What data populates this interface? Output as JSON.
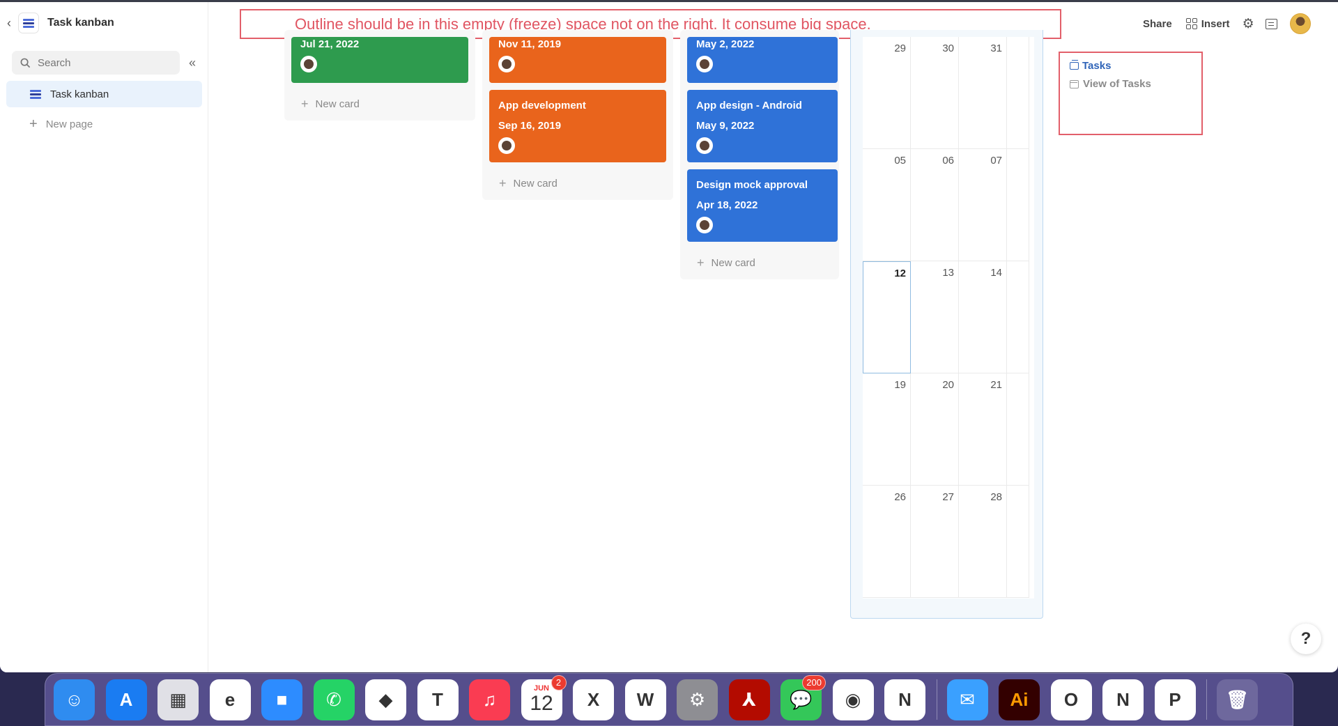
{
  "sidebar": {
    "back_glyph": "‹",
    "title": "Task kanban",
    "search_placeholder": "Search",
    "collapse_glyph": "«",
    "items": [
      {
        "label": "Task kanban",
        "icon": "kanban-icon"
      }
    ],
    "new_page_label": "New page"
  },
  "toolbar": {
    "share_label": "Share",
    "insert_label": "Insert",
    "settings_icon": "gear-icon",
    "comments_icon": "comment-icon"
  },
  "annotation": {
    "text": "Outline should be in this empty (freeze) space not on the right. It consume big space.",
    "color": "#e25f6a"
  },
  "kanban": {
    "columns": [
      {
        "color": "#2e9b4e",
        "cards": [
          {
            "date": "Jul 21, 2022"
          }
        ],
        "new_card_label": "New card"
      },
      {
        "color": "#e9641c",
        "cards": [
          {
            "date": "Nov 11, 2019"
          },
          {
            "title": "App development",
            "date": "Sep 16, 2019"
          }
        ],
        "new_card_label": "New card"
      },
      {
        "color": "#2f72d8",
        "cards": [
          {
            "date": "May 2, 2022"
          },
          {
            "title": "App design - Android",
            "date": "May 9, 2022"
          },
          {
            "title": "Design mock approval",
            "date": "Apr 18, 2022"
          }
        ],
        "new_card_label": "New card"
      }
    ]
  },
  "calendar": {
    "rows": [
      [
        "29",
        "30",
        "31"
      ],
      [
        "05",
        "06",
        "07"
      ],
      [
        "12",
        "13",
        "14"
      ],
      [
        "19",
        "20",
        "21"
      ],
      [
        "26",
        "27",
        "28"
      ]
    ],
    "today": "12"
  },
  "outline": {
    "items": [
      {
        "label": "Tasks",
        "active": true
      },
      {
        "label": "View of Tasks",
        "active": false
      }
    ]
  },
  "help_label": "?",
  "dock": {
    "apps": [
      {
        "name": "finder",
        "color": "#2f8cf0",
        "glyph": "☺"
      },
      {
        "name": "app-store",
        "color": "#1a7cf2",
        "glyph": "A"
      },
      {
        "name": "launchpad",
        "color": "#e0e0e6",
        "glyph": "▦"
      },
      {
        "name": "edge",
        "color": "#ffffff",
        "glyph": "e"
      },
      {
        "name": "zoom",
        "color": "#2d8cff",
        "glyph": "■"
      },
      {
        "name": "whatsapp",
        "color": "#25d366",
        "glyph": "✆"
      },
      {
        "name": "affinity",
        "color": "#ffffff",
        "glyph": "◆"
      },
      {
        "name": "teams",
        "color": "#ffffff",
        "glyph": "T"
      },
      {
        "name": "music",
        "color": "#fa3c52",
        "glyph": "♫"
      },
      {
        "name": "calendar",
        "color": "#ffffff",
        "glyph": "12",
        "month": "JUN",
        "badge": "2"
      },
      {
        "name": "excel",
        "color": "#ffffff",
        "glyph": "X"
      },
      {
        "name": "word",
        "color": "#ffffff",
        "glyph": "W"
      },
      {
        "name": "system-settings",
        "color": "#8e8e93",
        "glyph": "⚙"
      },
      {
        "name": "acrobat",
        "color": "#b30b00",
        "glyph": "⅄"
      },
      {
        "name": "messages",
        "color": "#34c759",
        "glyph": "💬",
        "badge": "200"
      },
      {
        "name": "chrome",
        "color": "#ffffff",
        "glyph": "◉"
      },
      {
        "name": "notion",
        "color": "#ffffff",
        "glyph": "N"
      },
      {
        "name": "mail",
        "color": "#3aa0ff",
        "glyph": "✉"
      },
      {
        "name": "illustrator",
        "color": "#330000",
        "glyph": "Ai"
      },
      {
        "name": "outlook",
        "color": "#ffffff",
        "glyph": "O"
      },
      {
        "name": "news",
        "color": "#ffffff",
        "glyph": "N"
      },
      {
        "name": "powerpoint",
        "color": "#ffffff",
        "glyph": "P"
      },
      {
        "name": "trash",
        "color": "rgba(255,255,255,0.15)",
        "glyph": "🗑"
      }
    ]
  }
}
